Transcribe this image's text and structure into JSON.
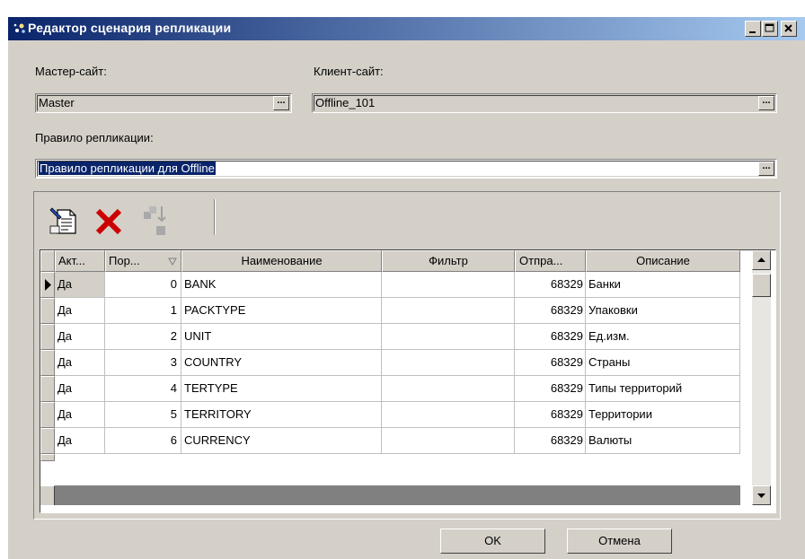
{
  "window": {
    "title": "Редактор сценария репликации"
  },
  "master_site": {
    "label": "Мастер-сайт:",
    "value": "Master",
    "browse_label": "..."
  },
  "client_site": {
    "label": "Клиент-сайт:",
    "value": "Offline_101",
    "browse_label": "..."
  },
  "replication_rule": {
    "label": "Правило репликации:",
    "value": "Правило репликации для Offline",
    "browse_label": "..."
  },
  "toolbar": {
    "icons": [
      "edit-document-icon",
      "delete-icon",
      "move-down-icon"
    ]
  },
  "grid": {
    "columns": [
      "Акт...",
      "Пор...",
      "Наименование",
      "Фильтр",
      "Отпра...",
      "Описание"
    ],
    "rows": [
      [
        "Да",
        "0",
        "BANK",
        "",
        "68329",
        "Банки"
      ],
      [
        "Да",
        "1",
        "PACKTYPE",
        "",
        "68329",
        "Упаковки"
      ],
      [
        "Да",
        "2",
        "UNIT",
        "",
        "68329",
        "Ед.изм."
      ],
      [
        "Да",
        "3",
        "COUNTRY",
        "",
        "68329",
        "Страны"
      ],
      [
        "Да",
        "4",
        "TERTYPE",
        "",
        "68329",
        "Типы территорий"
      ],
      [
        "Да",
        "5",
        "TERRITORY",
        "",
        "68329",
        "Территории"
      ],
      [
        "Да",
        "6",
        "CURRENCY",
        "",
        "68329",
        "Валюты"
      ]
    ]
  },
  "buttons": {
    "ok": "OK",
    "cancel": "Отмена"
  },
  "colors": {
    "title_start": "#0a246a",
    "title_end": "#a6caf0",
    "face": "#d4d0c8",
    "delete_red": "#cc0000"
  }
}
